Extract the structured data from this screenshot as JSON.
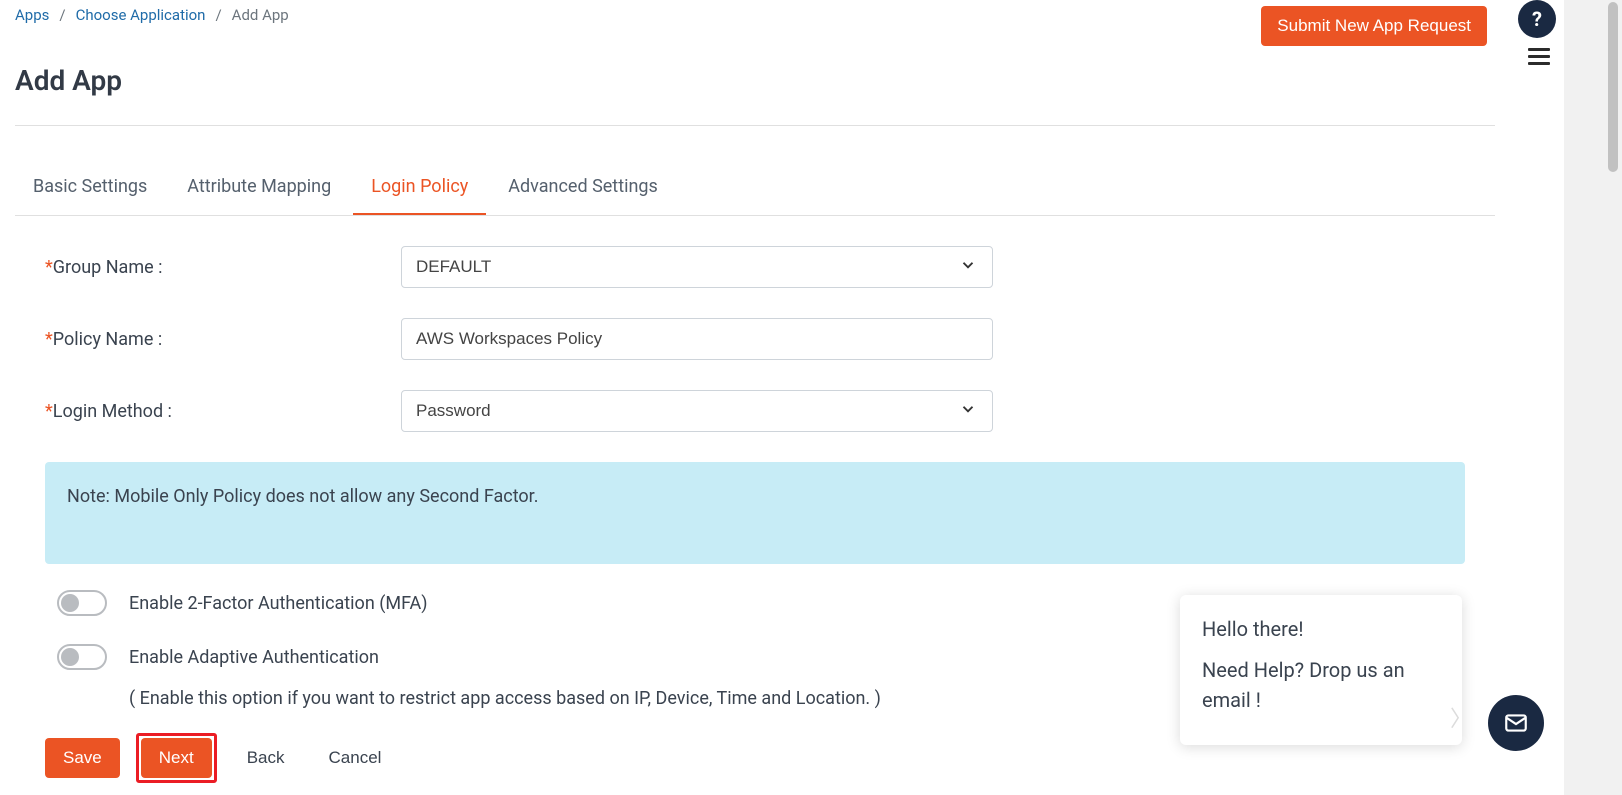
{
  "breadcrumb": {
    "apps": "Apps",
    "choose": "Choose Application",
    "current": "Add App"
  },
  "header": {
    "submit_label": "Submit New App Request",
    "page_title": "Add App"
  },
  "tabs": {
    "basic": "Basic Settings",
    "attribute": "Attribute Mapping",
    "login": "Login Policy",
    "advanced": "Advanced Settings"
  },
  "form": {
    "group_name_label": "Group Name :",
    "group_name_value": "DEFAULT",
    "policy_name_label": "Policy Name :",
    "policy_name_value": "AWS Workspaces Policy",
    "login_method_label": "Login Method :",
    "login_method_value": "Password",
    "note": "Note: Mobile Only Policy does not allow any Second Factor.",
    "mfa_label": "Enable 2-Factor Authentication (MFA)",
    "adaptive_label": "Enable Adaptive Authentication",
    "adaptive_sub": "( Enable this option if you want to restrict app access based on IP, Device, Time and Location. )"
  },
  "actions": {
    "save": "Save",
    "next": "Next",
    "back": "Back",
    "cancel": "Cancel"
  },
  "chat": {
    "line1": "Hello there!",
    "line2": "Need Help? Drop us an email !"
  },
  "icons": {
    "help": "?"
  }
}
